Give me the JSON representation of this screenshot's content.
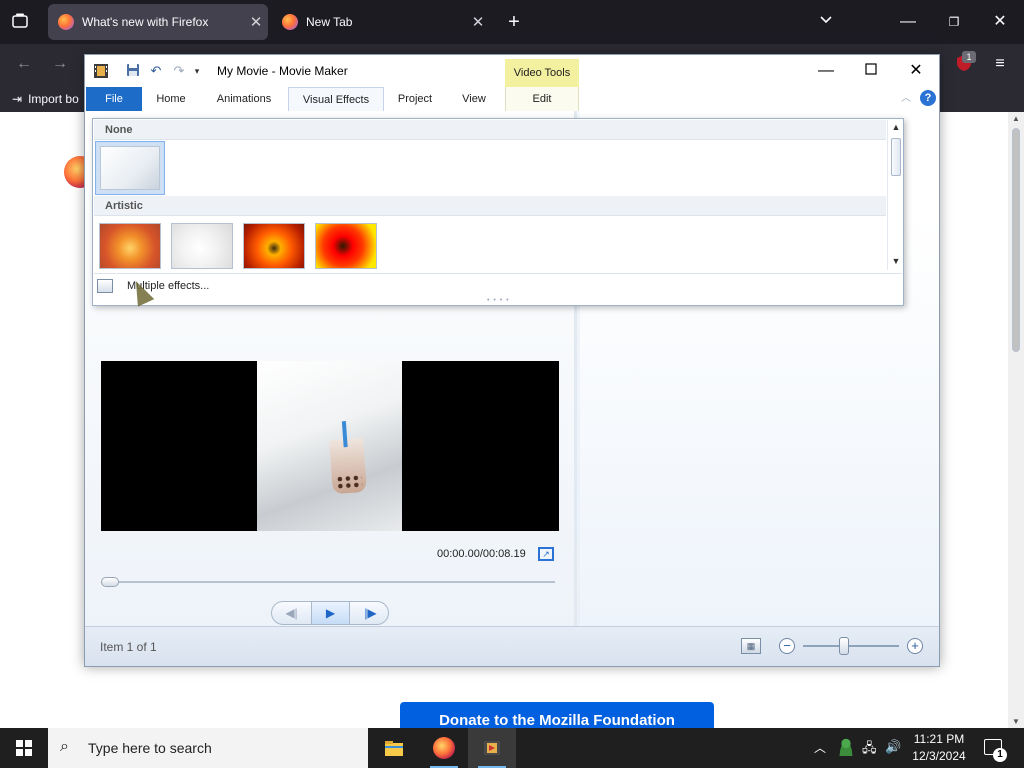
{
  "firefox": {
    "tabs": [
      {
        "title": "What's new with Firefox",
        "active": true
      },
      {
        "title": "New Tab",
        "active": false
      }
    ],
    "bookmarks": {
      "import_label": "Import bo"
    },
    "notifications_badge": "1",
    "donate_button": "Donate to the Mozilla Foundation",
    "icons": [
      "list-all-tabs-icon",
      "close-icon",
      "new-tab-icon",
      "chevron-down-icon",
      "minimize-icon",
      "restore-icon",
      "back-icon",
      "forward-icon",
      "extension-icon",
      "menu-icon"
    ]
  },
  "moviemaker": {
    "title": "My Movie - Movie Maker",
    "contextual_group": "Video Tools",
    "ribbon_tabs": [
      "File",
      "Home",
      "Animations",
      "Visual Effects",
      "Project",
      "View"
    ],
    "contextual_tab": "Edit",
    "selected_tab": "Visual Effects",
    "gallery": {
      "sections": [
        {
          "heading": "None",
          "items": [
            "No effect"
          ]
        },
        {
          "heading": "Artistic",
          "items": [
            "Artistic effect 1",
            "Artistic effect 2",
            "Artistic effect 3",
            "Artistic effect 4"
          ]
        }
      ],
      "footer_label": "Multiple effects..."
    },
    "preview": {
      "timecode": "00:00.00/00:08.19"
    },
    "status": {
      "item_text": "Item 1 of 1"
    },
    "colors": {
      "file_tab": "#1c6cc8",
      "contextual_tab": "#f3f0a0",
      "accent": "#2a72d4"
    }
  },
  "taskbar": {
    "search_placeholder": "Type here to search",
    "time": "11:21 PM",
    "date": "12/3/2024",
    "notification_count": "1",
    "apps": [
      "file-explorer",
      "firefox",
      "movie-maker"
    ]
  }
}
